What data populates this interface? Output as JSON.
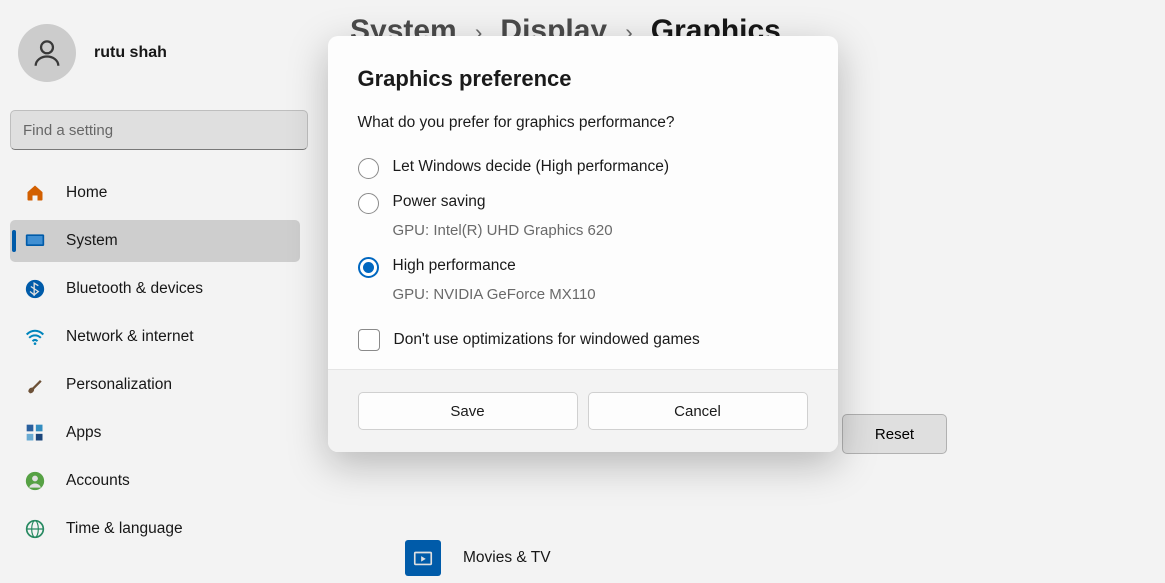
{
  "user": {
    "name": "rutu shah"
  },
  "search": {
    "placeholder": "Find a setting"
  },
  "sidebar": {
    "items": [
      {
        "label": "Home",
        "icon": "home"
      },
      {
        "label": "System",
        "icon": "system"
      },
      {
        "label": "Bluetooth & devices",
        "icon": "bluetooth"
      },
      {
        "label": "Network & internet",
        "icon": "wifi"
      },
      {
        "label": "Personalization",
        "icon": "brush"
      },
      {
        "label": "Apps",
        "icon": "apps"
      },
      {
        "label": "Accounts",
        "icon": "account"
      },
      {
        "label": "Time & language",
        "icon": "globe"
      }
    ]
  },
  "breadcrumb": {
    "a": "System",
    "b": "Display",
    "c": "Graphics"
  },
  "reset": {
    "label": "Reset"
  },
  "tile": {
    "label": "Movies & TV"
  },
  "modal": {
    "title": "Graphics preference",
    "question": "What do you prefer for graphics performance?",
    "options": [
      {
        "label": "Let Windows decide (High performance)",
        "sub": "",
        "selected": false
      },
      {
        "label": "Power saving",
        "sub": "GPU: Intel(R) UHD Graphics 620",
        "selected": false
      },
      {
        "label": "High performance",
        "sub": "GPU: NVIDIA GeForce MX110",
        "selected": true
      }
    ],
    "checkbox": {
      "label": "Don't use optimizations for windowed games",
      "checked": false
    },
    "save": "Save",
    "cancel": "Cancel"
  }
}
